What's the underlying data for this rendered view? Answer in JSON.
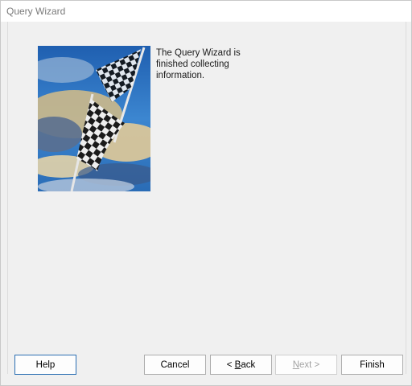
{
  "window": {
    "title": "Query Wizard"
  },
  "message": "The Query Wizard is finished collecting information.",
  "buttons": {
    "help": "Help",
    "cancel": "Cancel",
    "back": {
      "prefix": "< ",
      "mnemonic": "B",
      "rest": "ack"
    },
    "next": {
      "mnemonic": "N",
      "rest": "ext >"
    },
    "finish": "Finish"
  },
  "colors": {
    "sky": "#2f73c2",
    "cloud": "#d8c79a",
    "dialog_bg": "#f0f0f0",
    "help_border": "#2c6fb3"
  },
  "image": {
    "icon": "checkered-flag-icon"
  }
}
